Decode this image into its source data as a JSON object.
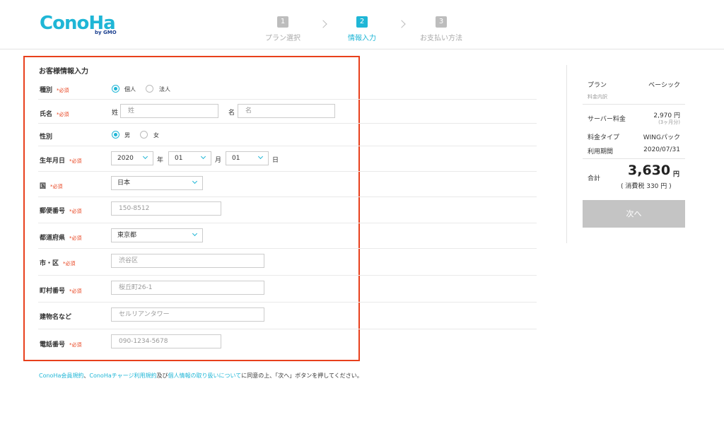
{
  "header": {
    "logo_text": "ConoHa",
    "logo_sub": "by GMO",
    "steps": [
      {
        "num": "1",
        "label": "プラン選択"
      },
      {
        "num": "2",
        "label": "情報入力"
      },
      {
        "num": "3",
        "label": "お支払い方法"
      }
    ]
  },
  "form": {
    "title": "お客様情報入力",
    "required_mark": "*必須",
    "type": {
      "label": "種別",
      "options": [
        "個人",
        "法人"
      ],
      "selected": "個人"
    },
    "name": {
      "label": "氏名",
      "last_label": "姓",
      "last_placeholder": "姓",
      "first_label": "名",
      "first_placeholder": "名"
    },
    "gender": {
      "label": "性別",
      "options": [
        "男",
        "女"
      ],
      "selected": "男"
    },
    "birth": {
      "label": "生年月日",
      "year": "2020",
      "year_unit": "年",
      "month": "01",
      "month_unit": "月",
      "day": "01",
      "day_unit": "日"
    },
    "country": {
      "label": "国",
      "value": "日本"
    },
    "postal": {
      "label": "郵便番号",
      "placeholder": "150-8512"
    },
    "prefecture": {
      "label": "都道府県",
      "value": "東京都"
    },
    "city": {
      "label": "市・区",
      "placeholder": "渋谷区"
    },
    "town": {
      "label": "町村番号",
      "placeholder": "桜丘町26-1"
    },
    "building": {
      "label": "建物名など",
      "placeholder": "セルリアンタワー"
    },
    "phone": {
      "label": "電話番号",
      "placeholder": "090-1234-5678"
    }
  },
  "footer": {
    "link1": "ConoHa会員規約",
    "sep1": "、",
    "link2": "ConoHaチャージ利用規約",
    "mid": "及び",
    "link3": "個人情報の取り扱いについて",
    "rest": "に同意の上、「次へ」ボタンを押してください。"
  },
  "summary": {
    "plan_label": "プラン",
    "plan_value": "ベーシック",
    "breakdown_label": "料金内訳",
    "server_fee_label": "サーバー料金",
    "server_fee_value": "2,970 円",
    "server_fee_note": "(3ヶ月分)",
    "fee_type_label": "料金タイプ",
    "fee_type_value": "WINGパック",
    "period_label": "利用期間",
    "period_value": "2020/07/31",
    "total_label": "合計",
    "total_value": "3,630",
    "total_unit": "円",
    "tax_note": "( 消費税 330 円 )",
    "next_button": "次へ"
  },
  "colors": {
    "accent": "#1fb6d6",
    "highlight_border": "#e8401c",
    "disabled_button": "#c4c4c4"
  }
}
